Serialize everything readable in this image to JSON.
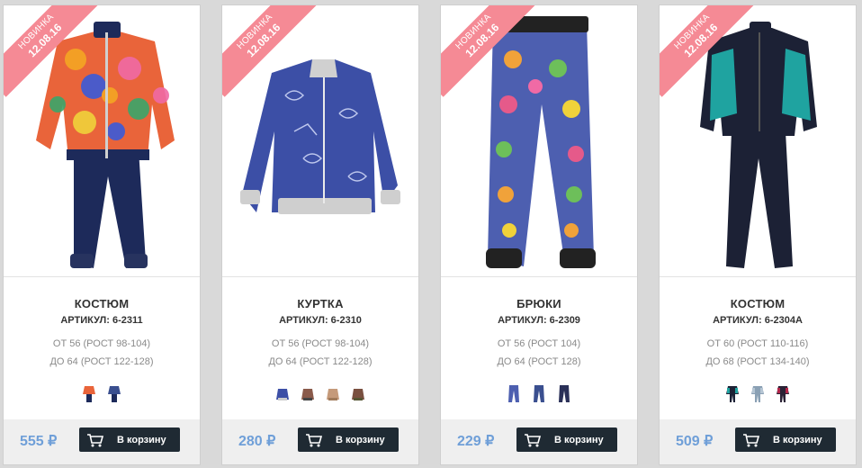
{
  "currency_symbol": "₽",
  "cart_label": "В корзину",
  "products": [
    {
      "badge_line1": "НОВИНКА",
      "badge_line2": "12.08.16",
      "title": "КОСТЮМ",
      "article": "АРТИКУЛ: 6-2311",
      "size_from": "ОТ 56 (РОСТ 98-104)",
      "size_to": "ДО 64 (РОСТ 122-128)",
      "price": "555 ₽",
      "swatch_icons": [
        "floral-suit-icon",
        "blue-suit-icon"
      ]
    },
    {
      "badge_line1": "НОВИНКА",
      "badge_line2": "12.08.16",
      "title": "КУРТКА",
      "article": "АРТИКУЛ: 6-2310",
      "size_from": "ОТ 56 (РОСТ 98-104)",
      "size_to": "ДО 64 (РОСТ 122-128)",
      "price": "280 ₽",
      "swatch_icons": [
        "blue-jacket-icon",
        "patterned-jacket-icon",
        "beige-jacket-icon",
        "brown-jacket-icon"
      ]
    },
    {
      "badge_line1": "НОВИНКА",
      "badge_line2": "12.08.16",
      "title": "БРЮКИ",
      "article": "АРТИКУЛ: 6-2309",
      "size_from": "ОТ 56 (РОСТ 104)",
      "size_to": "ДО 64 (РОСТ 128)",
      "price": "229 ₽",
      "swatch_icons": [
        "owl-pants-icon",
        "blue-pants-icon",
        "dark-pants-icon"
      ]
    },
    {
      "badge_line1": "НОВИНКА",
      "badge_line2": "12.08.16",
      "title": "КОСТЮМ",
      "article": "АРТИКУЛ: 6-2304А",
      "size_from": "ОТ 60 (РОСТ 110-116)",
      "size_to": "ДО 68 (РОСТ 134-140)",
      "price": "509 ₽",
      "swatch_icons": [
        "teal-suit-icon",
        "grey-suit-icon",
        "red-suit-icon"
      ]
    }
  ],
  "colors": {
    "ribbon": "#f58a95",
    "price": "#6f9fd8",
    "button": "#1f2a33"
  }
}
